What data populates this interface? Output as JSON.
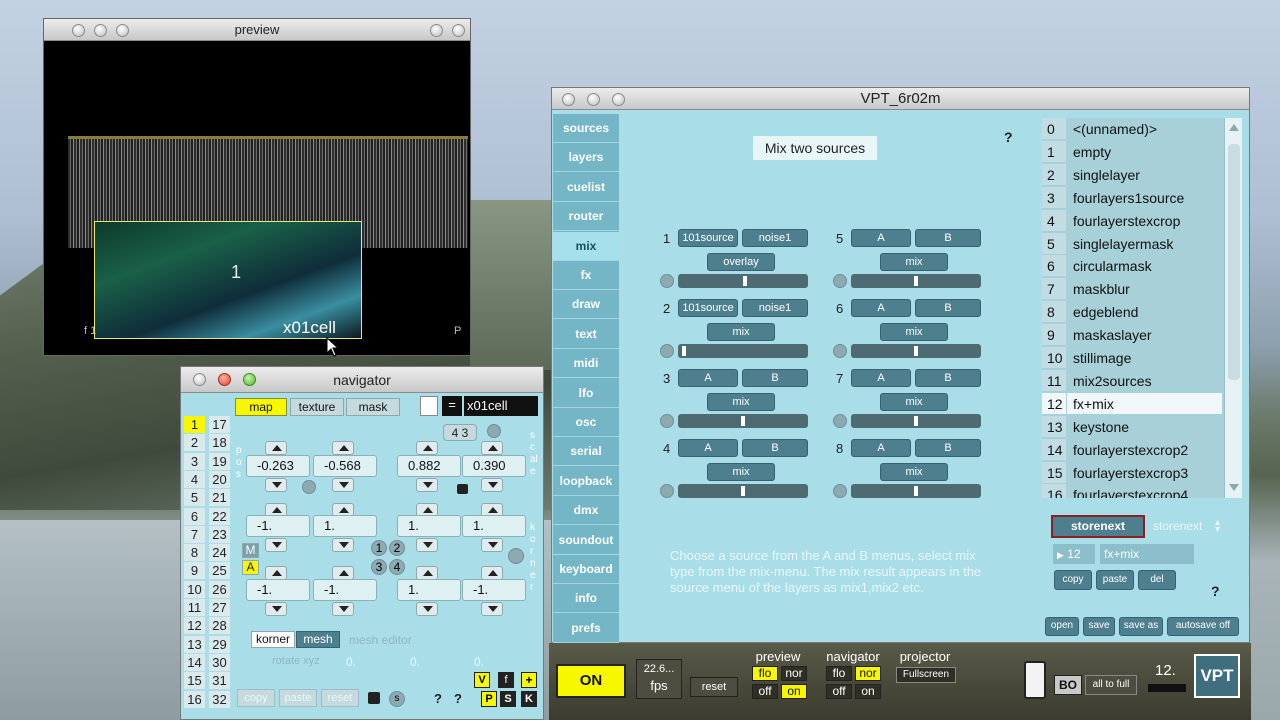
{
  "preview": {
    "title": "preview",
    "layer_number": "1",
    "cell_label": "x01cell",
    "corner_left": "f 1",
    "corner_right": "P"
  },
  "vpt": {
    "title": "VPT_6r02m",
    "help": "?",
    "tabs": [
      "sources",
      "layers",
      "cuelist",
      "router",
      "mix",
      "fx",
      "draw",
      "text",
      "midi",
      "lfo",
      "osc",
      "serial",
      "loopback",
      "dmx",
      "soundout",
      "keyboard",
      "info",
      "prefs"
    ],
    "active_tab": "mix",
    "heading": "Mix two sources",
    "mixers": [
      {
        "n": "1",
        "a": "101source",
        "b": "noise1",
        "type": "overlay",
        "level": 0.52
      },
      {
        "n": "2",
        "a": "101source",
        "b": "noise1",
        "type": "mix",
        "level": 0.02
      },
      {
        "n": "3",
        "a": "A",
        "b": "B",
        "type": "mix",
        "level": 0.5
      },
      {
        "n": "4",
        "a": "A",
        "b": "B",
        "type": "mix",
        "level": 0.5
      },
      {
        "n": "5",
        "a": "A",
        "b": "B",
        "type": "mix",
        "level": 0.5
      },
      {
        "n": "6",
        "a": "A",
        "b": "B",
        "type": "mix",
        "level": 0.5
      },
      {
        "n": "7",
        "a": "A",
        "b": "B",
        "type": "mix",
        "level": 0.5
      },
      {
        "n": "8",
        "a": "A",
        "b": "B",
        "type": "mix",
        "level": 0.5
      }
    ],
    "instructions": "Choose a source from the A and B menus, select mix type from the mix-menu. The mix result appears in the source menu of the layers as mix1,mix2 etc.",
    "presets": [
      {
        "n": "0",
        "name": "<(unnamed)>"
      },
      {
        "n": "1",
        "name": "empty"
      },
      {
        "n": "2",
        "name": "singlelayer"
      },
      {
        "n": "3",
        "name": "fourlayers1source"
      },
      {
        "n": "4",
        "name": "fourlayerstexcrop"
      },
      {
        "n": "5",
        "name": "singlelayermask"
      },
      {
        "n": "6",
        "name": "circularmask"
      },
      {
        "n": "7",
        "name": "maskblur"
      },
      {
        "n": "8",
        "name": "edgeblend"
      },
      {
        "n": "9",
        "name": "maskaslayer"
      },
      {
        "n": "10",
        "name": "stillimage"
      },
      {
        "n": "11",
        "name": "mix2sources"
      },
      {
        "n": "12",
        "name": "fx+mix"
      },
      {
        "n": "13",
        "name": "keystone"
      },
      {
        "n": "14",
        "name": "fourlayerstexcrop2"
      },
      {
        "n": "15",
        "name": "fourlayerstexcrop3"
      },
      {
        "n": "16",
        "name": "fourlayerstexcrop4"
      }
    ],
    "selected_preset": "12",
    "storenext_btn": "storenext",
    "storenext_menu": "storenext",
    "current_num": "12",
    "current_name": "fx+mix",
    "copy": "copy",
    "paste": "paste",
    "del": "del",
    "help2": "?",
    "open": "open",
    "save": "save",
    "save_as": "save as",
    "autosave": "autosave off"
  },
  "bottom": {
    "on": "ON",
    "fps_value": "22.6...",
    "fps_label": "fps",
    "reset": "reset",
    "preview_label": "preview",
    "navigator_label": "navigator",
    "projector_label": "projector",
    "flo": "flo",
    "nor": "nor",
    "off": "off",
    "on_small": "on",
    "fullscreen": "Fullscreen",
    "bo": "BO",
    "all_to_full": "all to full",
    "level": "12.",
    "logo": "VPT"
  },
  "navigator": {
    "title": "navigator",
    "tabs": [
      "map",
      "texture",
      "mask"
    ],
    "eq": "=",
    "cell": "x01cell",
    "layers_left": [
      "1",
      "2",
      "3",
      "4",
      "5",
      "6",
      "7",
      "8",
      "9",
      "10",
      "11",
      "12",
      "13",
      "14",
      "15",
      "16"
    ],
    "layers_right": [
      "17",
      "18",
      "19",
      "20",
      "21",
      "22",
      "23",
      "24",
      "25",
      "26",
      "27",
      "28",
      "29",
      "30",
      "31",
      "32"
    ],
    "pos_label": "pos",
    "scale_label": "scale",
    "korner_vlabel": "korner",
    "pos_values": [
      "-0.263",
      "-0.568"
    ],
    "scale_values": [
      "0.882",
      "0.390"
    ],
    "row2": [
      "-1.",
      "1.",
      "1.",
      "1."
    ],
    "row3": [
      "-1.",
      "-1.",
      "1.",
      "-1."
    ],
    "badge43": "4 3",
    "corners": [
      "1",
      "2",
      "3",
      "4"
    ],
    "m": "M",
    "a": "A",
    "korner_tab": "korner",
    "mesh_tab": "mesh",
    "mesh_editor": "mesh editor",
    "rotate": "rotate xyz",
    "rot_values": [
      "0.",
      "0.",
      "0."
    ],
    "copy": "copy",
    "paste": "paste",
    "reset": "reset",
    "s": "s",
    "q": "?",
    "v": "V",
    "f": "f",
    "plus": "+",
    "p": "P",
    "s2": "S",
    "k": "K"
  }
}
